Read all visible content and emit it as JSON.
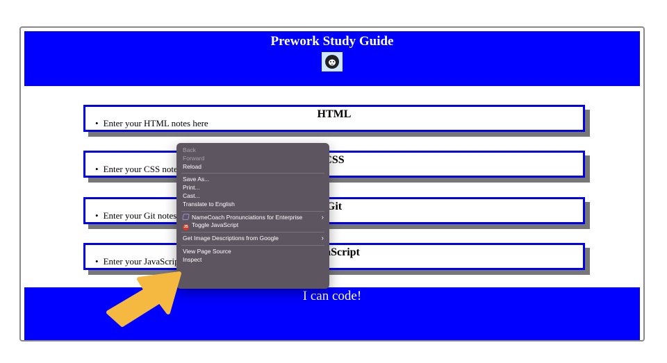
{
  "page": {
    "header_title": "Prework Study Guide",
    "footer_text": "I can code!"
  },
  "cards": [
    {
      "title": "HTML",
      "note": "Enter your HTML notes here"
    },
    {
      "title": "CSS",
      "note": "Enter your CSS notes here"
    },
    {
      "title": "Git",
      "note": "Enter your Git notes here"
    },
    {
      "title": "JavaScript",
      "note": "Enter your JavaScript notes here"
    }
  ],
  "context_menu": {
    "items": [
      {
        "label": "Back",
        "disabled": true
      },
      {
        "label": "Forward",
        "disabled": true
      },
      {
        "label": "Reload"
      },
      {
        "label": "Save As..."
      },
      {
        "label": "Print..."
      },
      {
        "label": "Cast..."
      },
      {
        "label": "Translate to English"
      },
      {
        "label": "NameCoach Pronunciations for Enterprise",
        "icon": "namecoach-extension-icon",
        "submenu": true
      },
      {
        "label": "Toggle JavaScript",
        "icon": "javascript-toggle-icon"
      },
      {
        "label": "Get Image Descriptions from Google",
        "submenu": true
      },
      {
        "label": "View Page Source"
      },
      {
        "label": "Inspect"
      }
    ],
    "js_badge": "JS"
  },
  "colors": {
    "header_blue": "#0000ff",
    "card_border": "#0000ee",
    "card_shadow": "#777777",
    "menu_bg": "#5d5560",
    "arrow": "#f5b942"
  },
  "icons": {
    "logo": "cat-logo-icon",
    "pointer": "pointing-arrow-icon"
  }
}
